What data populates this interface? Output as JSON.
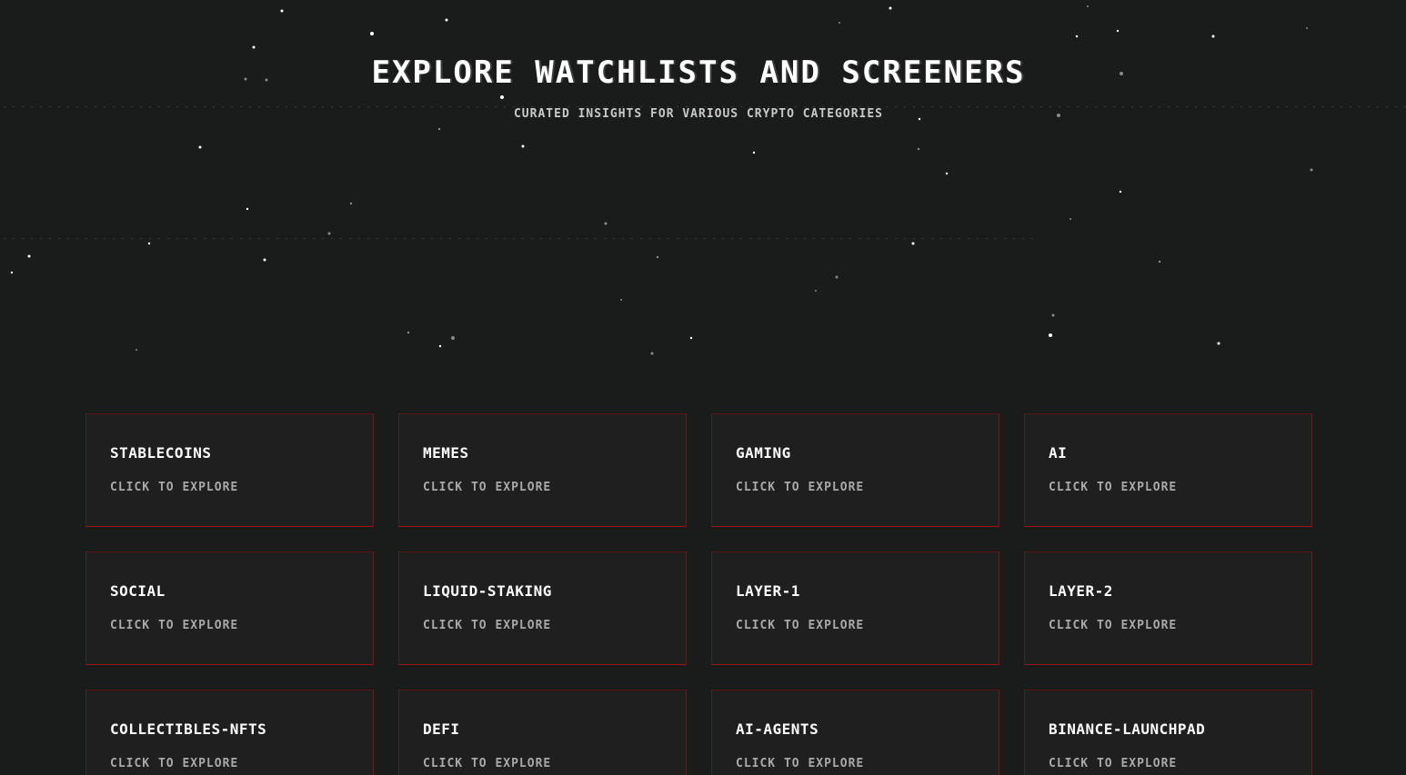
{
  "hero": {
    "title": "Explore Watchlists and Screeners",
    "subtitle": "Curated insights for various crypto categories"
  },
  "categories": [
    {
      "title": "Stablecoins",
      "cta": "Click to explore"
    },
    {
      "title": "Memes",
      "cta": "Click to explore"
    },
    {
      "title": "Gaming",
      "cta": "Click to explore"
    },
    {
      "title": "AI",
      "cta": "Click to explore"
    },
    {
      "title": "Social",
      "cta": "Click to explore"
    },
    {
      "title": "Liquid-staking",
      "cta": "Click to explore"
    },
    {
      "title": "Layer-1",
      "cta": "Click to explore"
    },
    {
      "title": "Layer-2",
      "cta": "Click to explore"
    },
    {
      "title": "Collectibles-nfts",
      "cta": "Click to explore"
    },
    {
      "title": "Defi",
      "cta": "Click to explore"
    },
    {
      "title": "AI-agents",
      "cta": "Click to explore"
    },
    {
      "title": "Binance-launchpad",
      "cta": "Click to explore"
    }
  ],
  "colors": {
    "background": "#1a1b1b",
    "card_background": "#1f1f20",
    "card_accent_border": "#a01414",
    "title_text": "#ffffff",
    "muted_text": "#a9a9a9"
  }
}
